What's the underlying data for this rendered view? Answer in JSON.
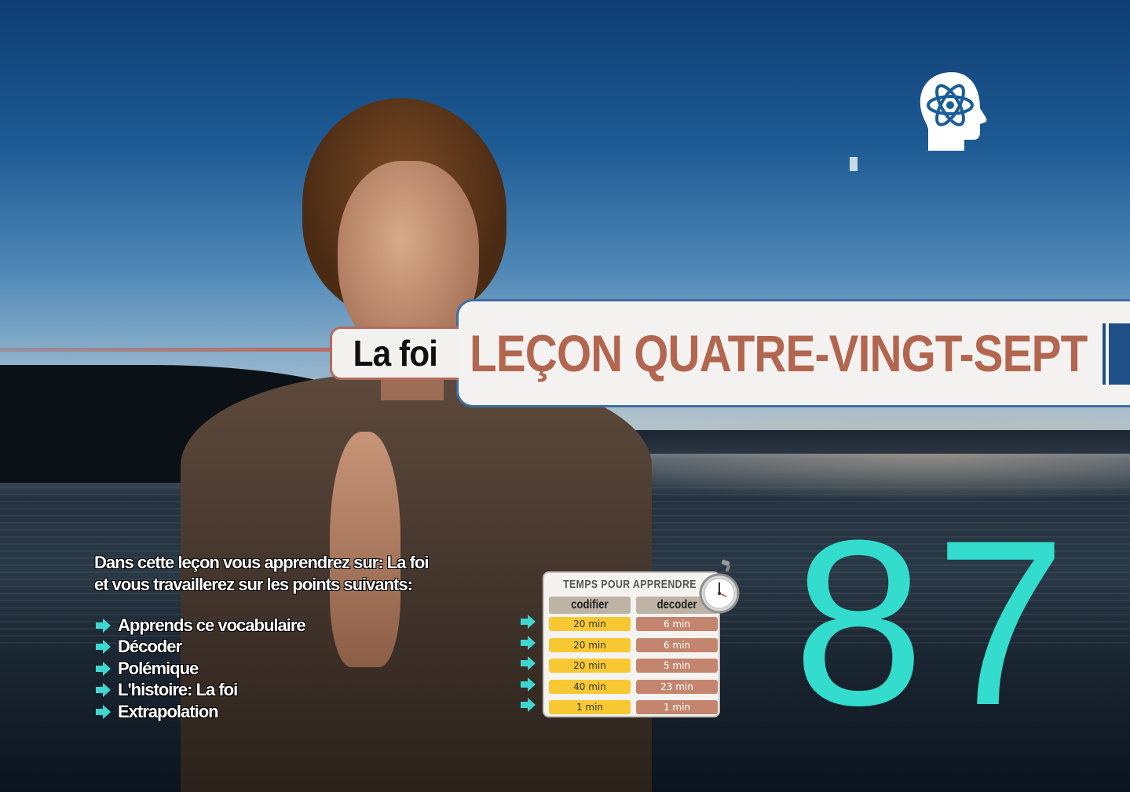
{
  "header": {
    "subtitle": "La foi",
    "title": "LEÇON QUATRE-VINGT-SEPT"
  },
  "intro": {
    "line1": "Dans cette leçon vous apprendrez sur: La foi",
    "line2": "et vous travaillerez sur les points suivants:"
  },
  "points": [
    "Apprends ce vocabulaire",
    "Décoder",
    "Polémique",
    "L'histoire: La foi",
    "Extrapolation"
  ],
  "time_table": {
    "title": "TEMPS POUR APPRENDRE",
    "columns": [
      "codifier",
      "decoder"
    ],
    "rows": [
      [
        "20 min",
        "6 min"
      ],
      [
        "20 min",
        "6 min"
      ],
      [
        "20 min",
        "5 min"
      ],
      [
        "40 min",
        "23 min"
      ],
      [
        "1 min",
        "1 min"
      ]
    ]
  },
  "lesson_number": "87",
  "colors": {
    "accent": "#33dccc",
    "title": "#b3664f",
    "band_border": "#3f6fa3",
    "cell_yellow": "#f7c832",
    "cell_brown": "#c4856f"
  },
  "icons": {
    "logo": "head-atom-icon",
    "timer": "stopwatch-icon",
    "bullet": "arrow-right-icon"
  }
}
